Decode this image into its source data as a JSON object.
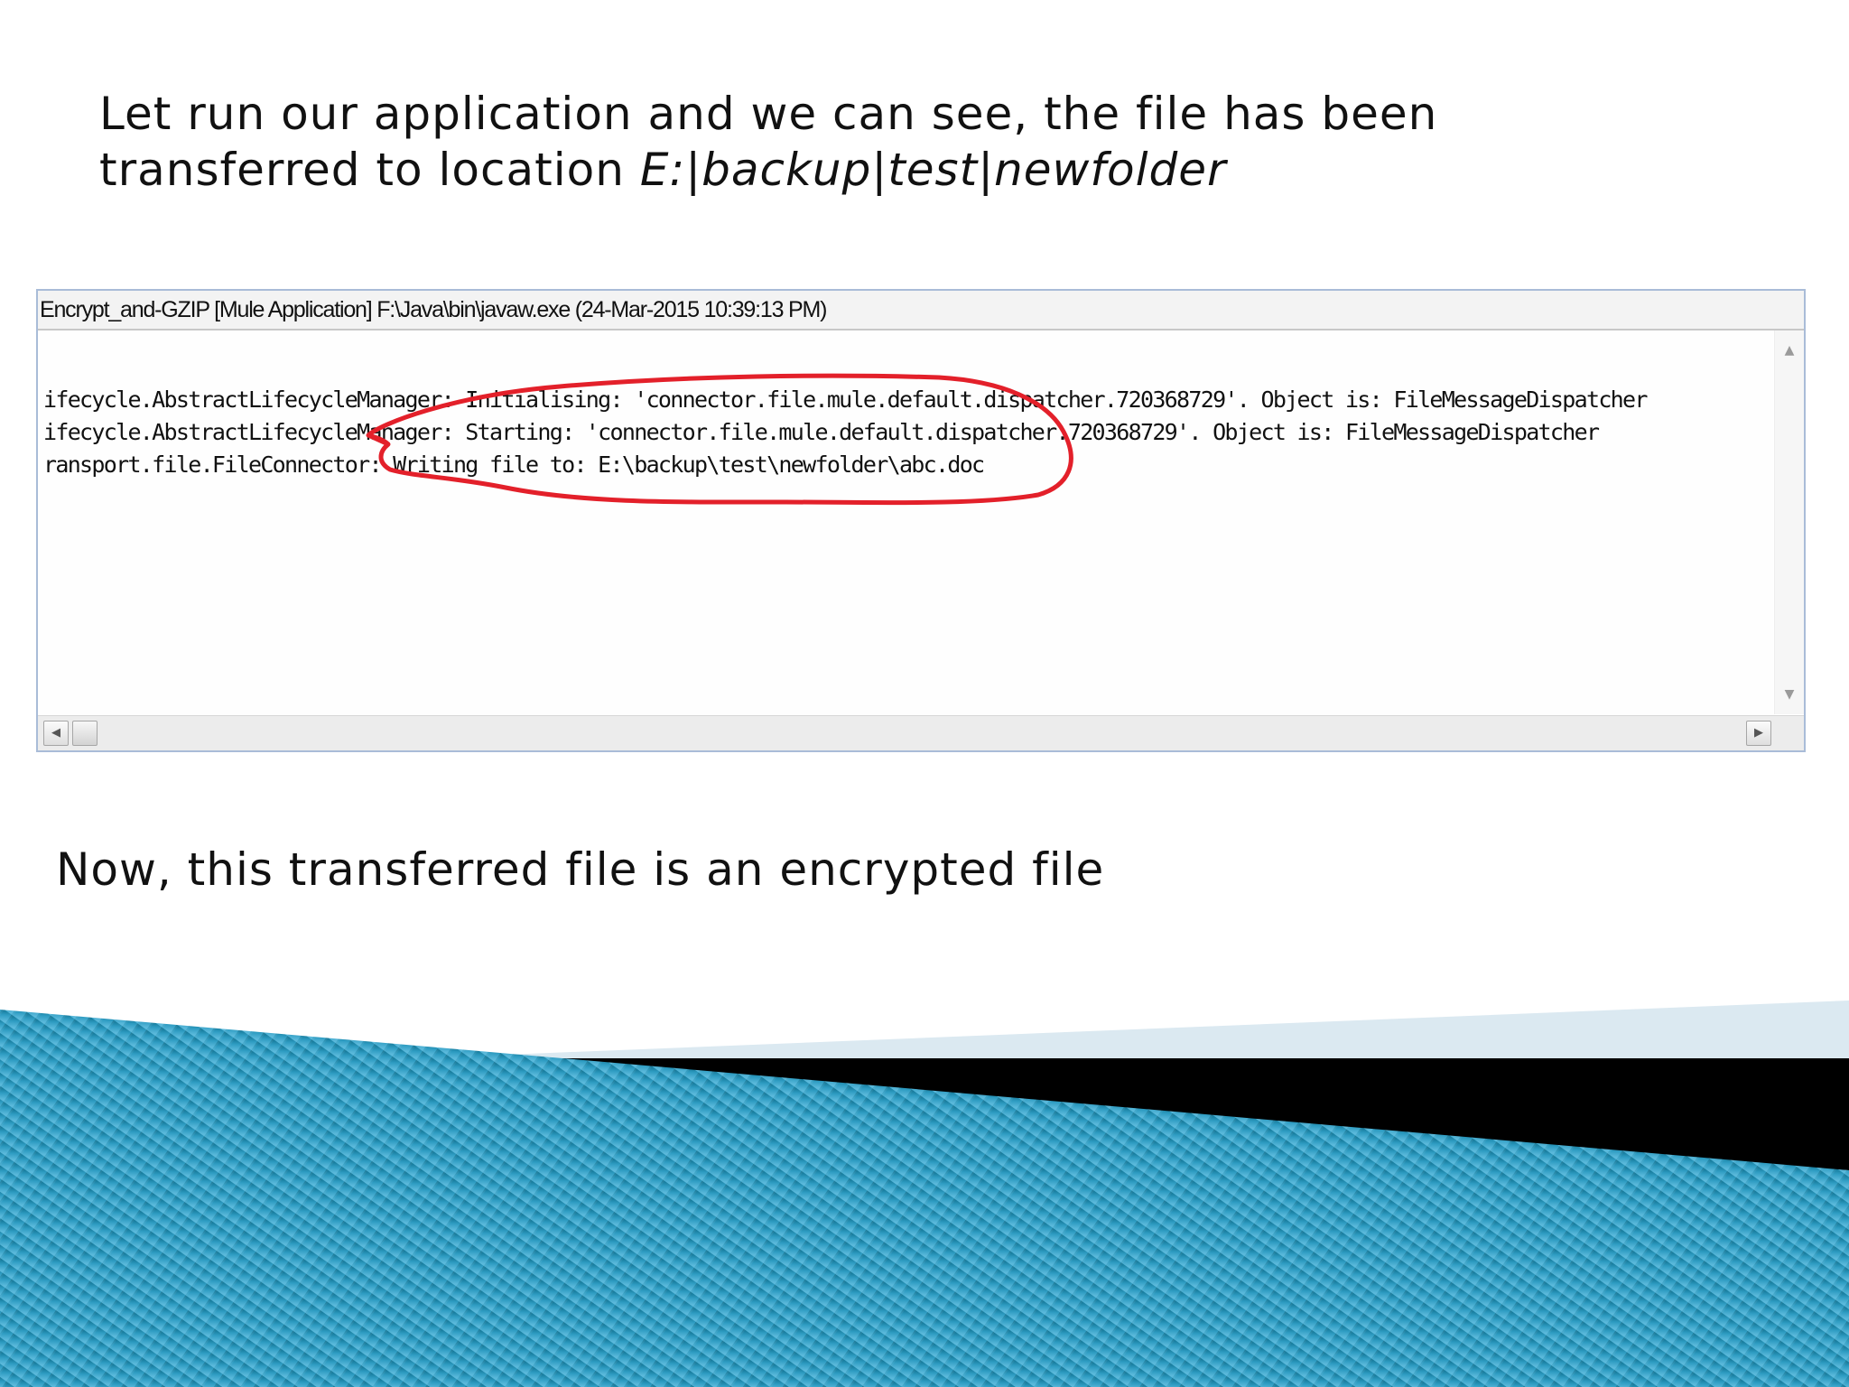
{
  "slide": {
    "heading_line1": "Let run our application and we can see, the file has been",
    "heading_line2_prefix": "transferred to location ",
    "heading_path": "E:|backup|test|newfolder",
    "caption": "Now, this transferred file is an encrypted file"
  },
  "console": {
    "title": "Encrypt_and-GZIP [Mule Application] F:\\Java\\bin\\javaw.exe (24-Mar-2015 10:39:13 PM)",
    "lines": [
      "ifecycle.AbstractLifecycleManager: Initialising: 'connector.file.mule.default.dispatcher.720368729'. Object is: FileMessageDispatcher",
      "ifecycle.AbstractLifecycleManager: Starting: 'connector.file.mule.default.dispatcher.720368729'. Object is: FileMessageDispatcher",
      "ransport.file.FileConnector: Writing file to: E:\\backup\\test\\newfolder\\abc.doc"
    ],
    "scroll_icons": {
      "up": "scroll-up-arrow-icon",
      "down": "scroll-down-arrow-icon",
      "left": "scroll-left-arrow-icon",
      "right": "scroll-right-arrow-icon"
    }
  },
  "colors": {
    "annotation": "#e3202a",
    "band_dark": "#0e6f8e",
    "band_light": "#5bb9db",
    "band_black": "#000000",
    "band_pale": "#dbe9f1"
  }
}
